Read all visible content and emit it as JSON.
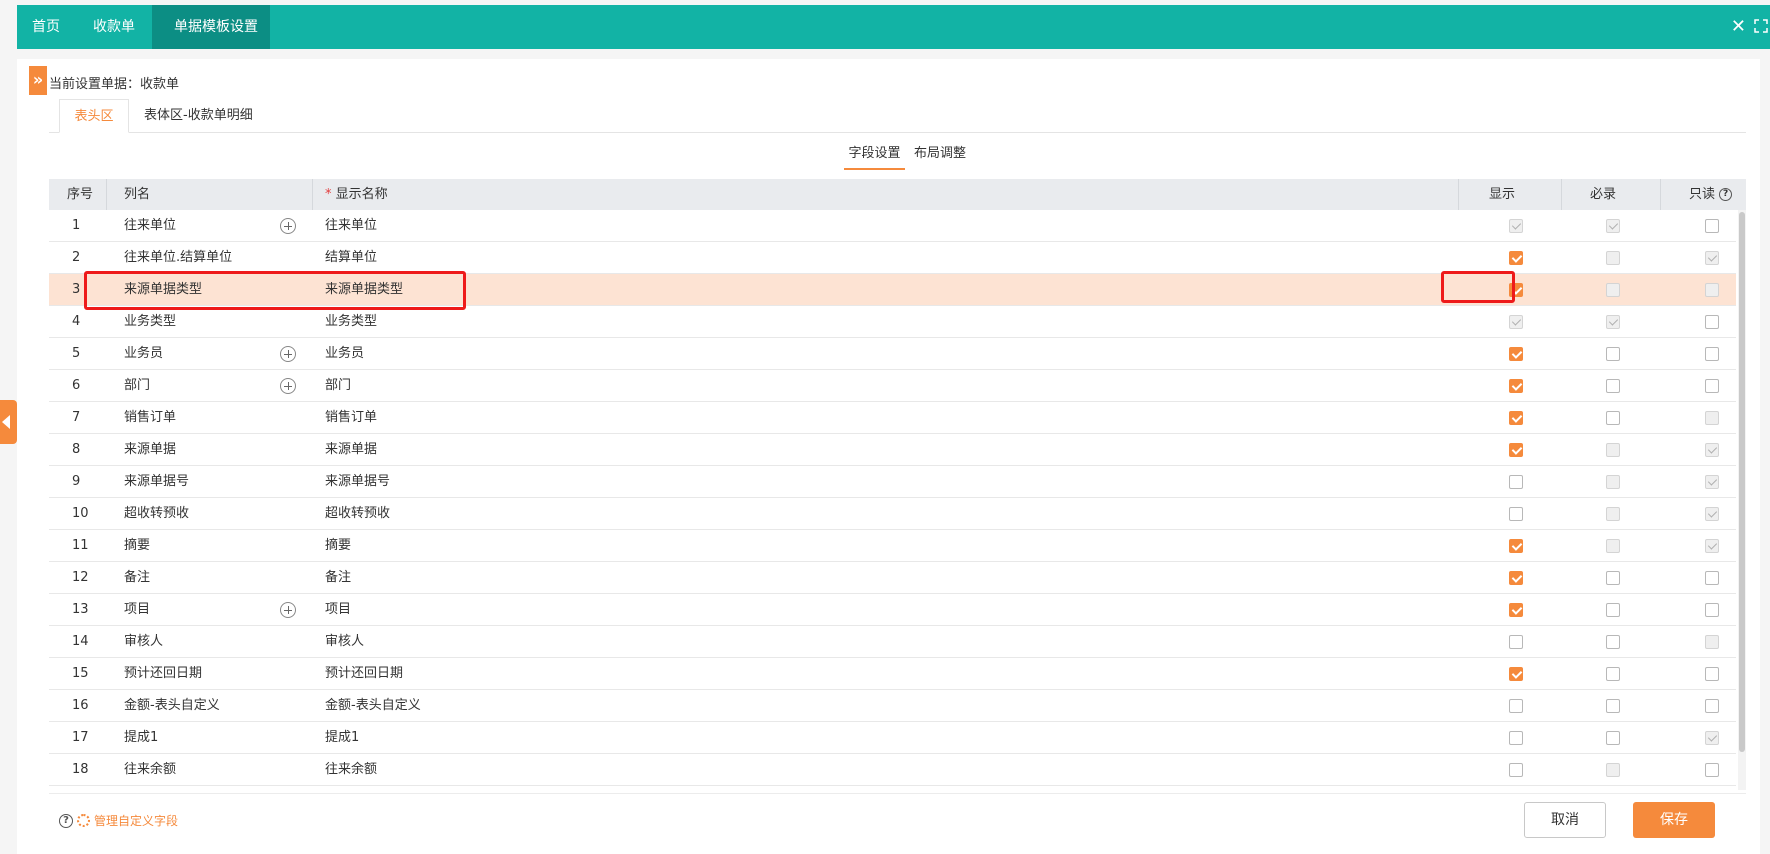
{
  "tabs": [
    {
      "label": "首页",
      "closable": false,
      "active": false
    },
    {
      "label": "收款单",
      "closable": true,
      "active": false
    },
    {
      "label": "单据模板设置",
      "closable": true,
      "active": true
    }
  ],
  "close_glyph": "×",
  "window": {
    "close_glyph": "✕"
  },
  "current_doc": "当前设置单据：收款单",
  "expand_glyph": "»",
  "section_tabs": [
    {
      "label": "表头区",
      "active": true
    },
    {
      "label": "表体区-收款单明细",
      "active": false
    }
  ],
  "sub_tabs": [
    {
      "label": "字段设置",
      "active": true
    },
    {
      "label": "布局调整",
      "active": false
    }
  ],
  "grid": {
    "headers": {
      "index": "序号",
      "column": "列名",
      "required_mark": "*",
      "display_name": "显示名称",
      "show": "显示",
      "required": "必录",
      "readonly": "只读",
      "help_glyph": "?"
    },
    "rows": [
      {
        "index": "1",
        "column": "往来单位",
        "name": "往来单位",
        "plus": true,
        "show": "dchk",
        "required": "dchk",
        "readonly": "off",
        "highlight": false
      },
      {
        "index": "2",
        "column": "往来单位.结算单位",
        "name": "结算单位",
        "plus": false,
        "show": "on",
        "required": "dis",
        "readonly": "dchk",
        "highlight": false
      },
      {
        "index": "3",
        "column": "来源单据类型",
        "name": "来源单据类型",
        "plus": false,
        "show": "on",
        "required": "dis",
        "readonly": "dis",
        "highlight": true
      },
      {
        "index": "4",
        "column": "业务类型",
        "name": "业务类型",
        "plus": false,
        "show": "dchk",
        "required": "dchk",
        "readonly": "off",
        "highlight": false
      },
      {
        "index": "5",
        "column": "业务员",
        "name": "业务员",
        "plus": true,
        "show": "on",
        "required": "off",
        "readonly": "off",
        "highlight": false
      },
      {
        "index": "6",
        "column": "部门",
        "name": "部门",
        "plus": true,
        "show": "on",
        "required": "off",
        "readonly": "off",
        "highlight": false
      },
      {
        "index": "7",
        "column": "销售订单",
        "name": "销售订单",
        "plus": false,
        "show": "on",
        "required": "off",
        "readonly": "dis",
        "highlight": false
      },
      {
        "index": "8",
        "column": "来源单据",
        "name": "来源单据",
        "plus": false,
        "show": "on",
        "required": "dis",
        "readonly": "dchk",
        "highlight": false
      },
      {
        "index": "9",
        "column": "来源单据号",
        "name": "来源单据号",
        "plus": false,
        "show": "off",
        "required": "dis",
        "readonly": "dchk",
        "highlight": false
      },
      {
        "index": "10",
        "column": "超收转预收",
        "name": "超收转预收",
        "plus": false,
        "show": "off",
        "required": "dis",
        "readonly": "dchk",
        "highlight": false
      },
      {
        "index": "11",
        "column": "摘要",
        "name": "摘要",
        "plus": false,
        "show": "on",
        "required": "dis",
        "readonly": "dchk",
        "highlight": false
      },
      {
        "index": "12",
        "column": "备注",
        "name": "备注",
        "plus": false,
        "show": "on",
        "required": "off",
        "readonly": "off",
        "highlight": false
      },
      {
        "index": "13",
        "column": "项目",
        "name": "项目",
        "plus": true,
        "show": "on",
        "required": "off",
        "readonly": "off",
        "highlight": false
      },
      {
        "index": "14",
        "column": "审核人",
        "name": "审核人",
        "plus": false,
        "show": "off",
        "required": "off",
        "readonly": "dis",
        "highlight": false
      },
      {
        "index": "15",
        "column": "预计还回日期",
        "name": "预计还回日期",
        "plus": false,
        "show": "on",
        "required": "off",
        "readonly": "off",
        "highlight": false
      },
      {
        "index": "16",
        "column": "金额-表头自定义",
        "name": "金额-表头自定义",
        "plus": false,
        "show": "off",
        "required": "off",
        "readonly": "off",
        "highlight": false
      },
      {
        "index": "17",
        "column": "提成1",
        "name": "提成1",
        "plus": false,
        "show": "off",
        "required": "off",
        "readonly": "dchk",
        "highlight": false
      },
      {
        "index": "18",
        "column": "往来余额",
        "name": "往来余额",
        "plus": false,
        "show": "off",
        "required": "dis",
        "readonly": "off",
        "highlight": false
      }
    ]
  },
  "footer": {
    "help_glyph": "?",
    "manage_label": "管理自定义字段",
    "cancel_label": "取消",
    "save_label": "保存"
  },
  "colors": {
    "topbar": "#12b3a5",
    "active_tab": "#0c8e84",
    "accent": "#f58a3c",
    "highlight_row": "#fde3d3",
    "annotation": "#ee1a1a"
  }
}
